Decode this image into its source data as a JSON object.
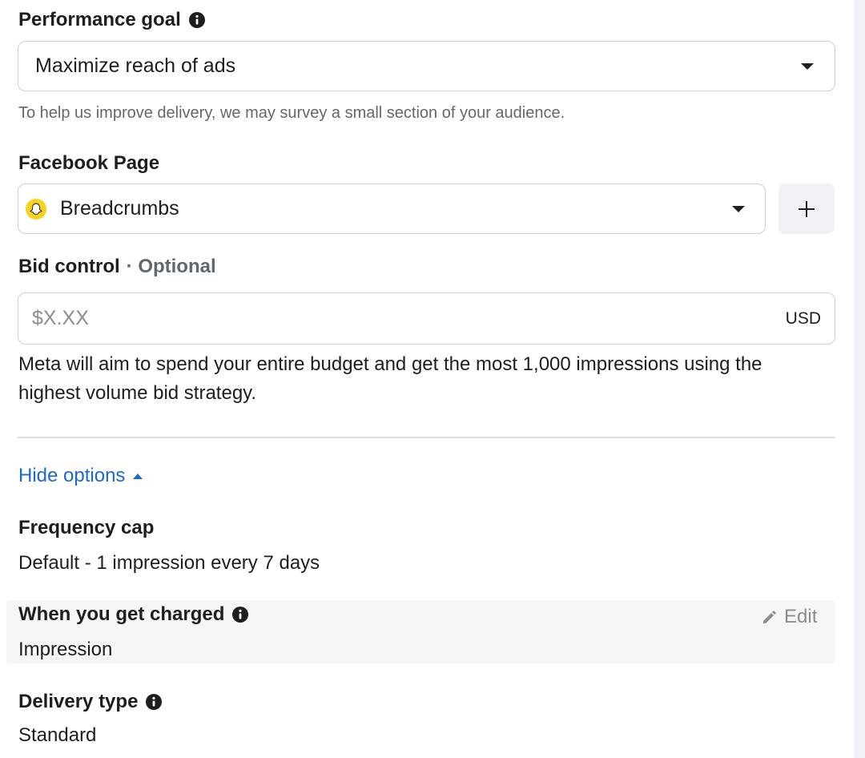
{
  "performance_goal": {
    "label": "Performance goal",
    "selected": "Maximize reach of ads",
    "helper": "To help us improve delivery, we may survey a small section of your audience."
  },
  "facebook_page": {
    "label": "Facebook Page",
    "selected": "Breadcrumbs"
  },
  "bid_control": {
    "label": "Bid control",
    "optional": "· Optional",
    "placeholder": "$X.XX",
    "currency": "USD",
    "description": "Meta will aim to spend your entire budget and get the most 1,000 impressions using the highest volume bid strategy."
  },
  "options_toggle": "Hide options",
  "frequency_cap": {
    "label": "Frequency cap",
    "value": "Default - 1 impression every 7 days"
  },
  "when_charged": {
    "label": "When you get charged",
    "value": "Impression",
    "edit_label": "Edit"
  },
  "delivery_type": {
    "label": "Delivery type",
    "value": "Standard"
  },
  "icons": {
    "info": "info-icon",
    "dropdown": "caret-down-icon",
    "add": "plus-icon",
    "edit": "pencil-icon",
    "page_avatar": "page-avatar-icon"
  },
  "colors": {
    "link": "#1b67d6",
    "text": "#1c1e21",
    "secondary": "#65676b",
    "border": "#ccd0d5",
    "page_avatar": "#f7d21e"
  }
}
